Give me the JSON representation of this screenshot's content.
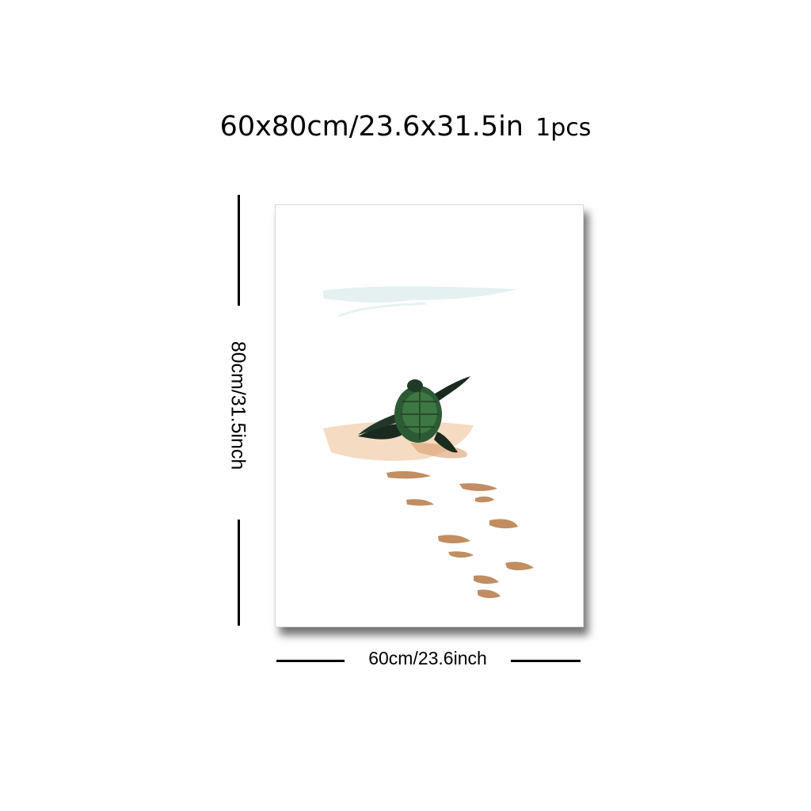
{
  "title": {
    "size": "60x80cm/23.6x31.5in",
    "quantity": "1pcs"
  },
  "dimensions": {
    "height_label": "80cm/31.5inch",
    "width_label": "60cm/23.6inch"
  },
  "artwork": {
    "subject": "turtle-hatchling-on-sand",
    "colors": {
      "turtle": "#1f3b27",
      "sand": "#e9b894",
      "tracks": "#a9703f",
      "water": "#cfe6e6"
    }
  }
}
